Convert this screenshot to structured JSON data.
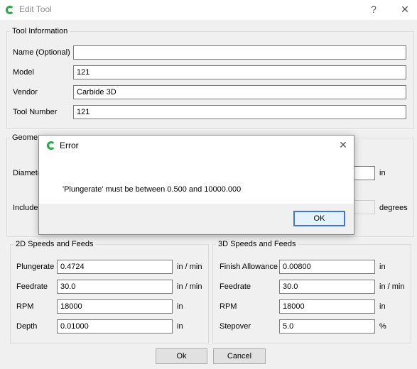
{
  "window": {
    "title": "Edit Tool",
    "help_glyph": "?",
    "close_glyph": "✕"
  },
  "tool_info": {
    "legend": "Tool Information",
    "fields": [
      {
        "label": "Name (Optional)",
        "value": ""
      },
      {
        "label": "Model",
        "value": "121"
      },
      {
        "label": "Vendor",
        "value": "Carbide 3D"
      },
      {
        "label": "Tool Number",
        "value": "121"
      }
    ]
  },
  "geometry": {
    "legend": "Geometry",
    "legend_visible": "Geome",
    "diameter_label": "Diamete",
    "diameter_unit": "in",
    "included_label": "Include",
    "included_unit": "degrees"
  },
  "speeds_2d": {
    "legend": "2D Speeds and Feeds",
    "rows": [
      {
        "label": "Plungerate",
        "value": "0.4724",
        "unit": "in / min"
      },
      {
        "label": "Feedrate",
        "value": "30.0",
        "unit": "in / min"
      },
      {
        "label": "RPM",
        "value": "18000",
        "unit": "in"
      },
      {
        "label": "Depth",
        "value": "0.01000",
        "unit": "in"
      }
    ]
  },
  "speeds_3d": {
    "legend": "3D Speeds and Feeds",
    "rows": [
      {
        "label": "Finish Allowance",
        "value": "0.00800",
        "unit": "in"
      },
      {
        "label": "Feedrate",
        "value": "30.0",
        "unit": "in / min"
      },
      {
        "label": "RPM",
        "value": "18000",
        "unit": "in"
      },
      {
        "label": "Stepover",
        "value": "5.0",
        "unit": "%"
      }
    ]
  },
  "buttons": {
    "ok": "Ok",
    "cancel": "Cancel"
  },
  "error_dialog": {
    "title": "Error",
    "close_glyph": "✕",
    "message": "'Plungerate' must be between 0.500 and 10000.000",
    "ok": "OK"
  },
  "colors": {
    "accent": "#3a78d4",
    "app_icon": "#2aa84a",
    "background": "#f0f0f0"
  }
}
